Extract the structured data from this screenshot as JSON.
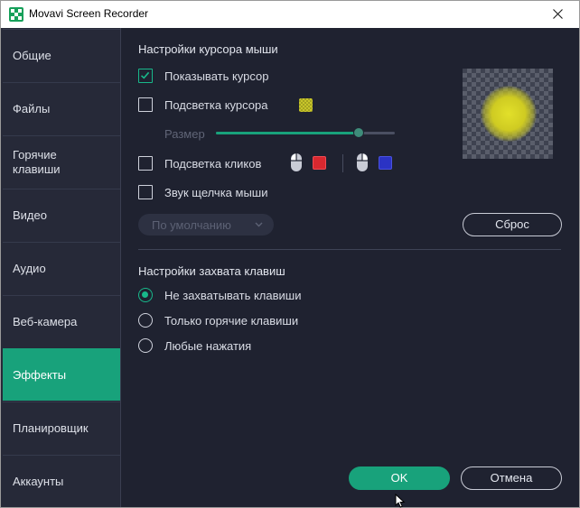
{
  "window": {
    "title": "Movavi Screen Recorder"
  },
  "sidebar": {
    "items": [
      {
        "label": "Общие",
        "active": false
      },
      {
        "label": "Файлы",
        "active": false
      },
      {
        "label": "Горячие клавиши",
        "active": false
      },
      {
        "label": "Видео",
        "active": false
      },
      {
        "label": "Аудио",
        "active": false
      },
      {
        "label": "Веб-камера",
        "active": false
      },
      {
        "label": "Эффекты",
        "active": true
      },
      {
        "label": "Планировщик",
        "active": false
      },
      {
        "label": "Аккаунты",
        "active": false
      }
    ]
  },
  "cursor_settings": {
    "title": "Настройки курсора мыши",
    "show_cursor": {
      "label": "Показывать курсор",
      "checked": true
    },
    "highlight_cursor": {
      "label": "Подсветка курсора",
      "checked": false,
      "color": "#c8c62a"
    },
    "size": {
      "label": "Размер",
      "value_fraction": 0.8
    },
    "highlight_clicks": {
      "label": "Подсветка кликов",
      "checked": false,
      "left_color": "#d8282f",
      "right_color": "#2b33c4"
    },
    "click_sound": {
      "label": "Звук щелчка мыши",
      "checked": false
    },
    "sound_select": {
      "value": "По умолчанию"
    },
    "reset_label": "Сброс"
  },
  "key_capture": {
    "title": "Настройки захвата клавиш",
    "options": [
      {
        "label": "Не захватывать клавиши",
        "selected": true
      },
      {
        "label": "Только горячие клавиши",
        "selected": false
      },
      {
        "label": "Любые нажатия",
        "selected": false
      }
    ]
  },
  "footer": {
    "ok_label": "OK",
    "cancel_label": "Отмена"
  },
  "colors": {
    "accent": "#18a27b",
    "background": "#1f2230",
    "sidebar": "#262938"
  }
}
